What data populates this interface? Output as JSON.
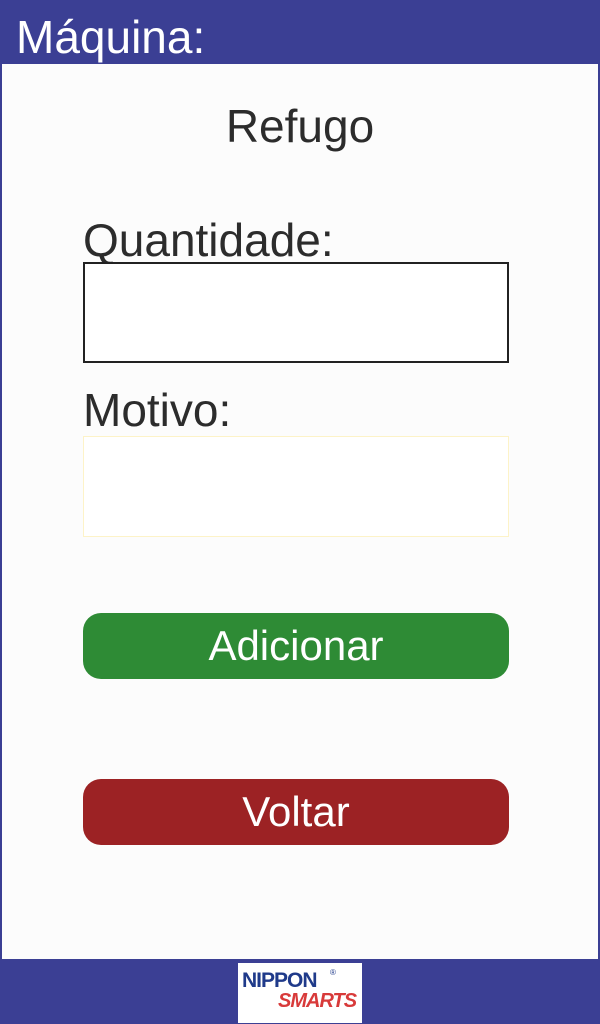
{
  "header": {
    "title": "Máquina:"
  },
  "screen": {
    "title": "Refugo"
  },
  "form": {
    "quantity": {
      "label": "Quantidade:",
      "value": "",
      "placeholder": ""
    },
    "reason": {
      "label": "Motivo:",
      "value": "",
      "placeholder": ""
    }
  },
  "actions": {
    "add_label": "Adicionar",
    "back_label": "Voltar"
  },
  "footer": {
    "logo": {
      "line1": "NIPPON",
      "registered": "®",
      "line2": "SMARTS"
    }
  },
  "colors": {
    "header_bar": "#3b3f94",
    "add_button": "#2e8b35",
    "back_button": "#9c2224",
    "logo_blue": "#1f3a8a",
    "logo_red": "#d83a3a"
  }
}
